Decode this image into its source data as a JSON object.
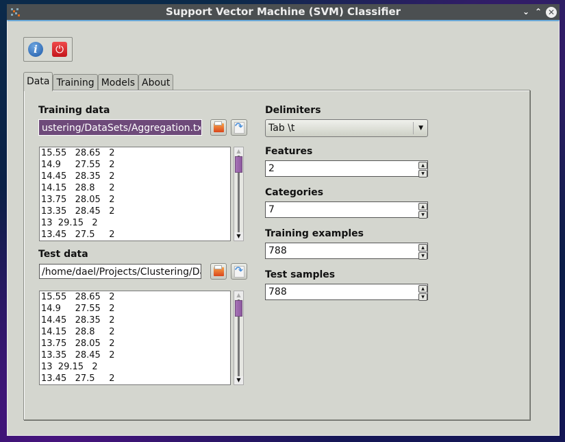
{
  "window": {
    "title": "Support Vector Machine (SVM) Classifier",
    "controls": {
      "minimize": "⌄",
      "maximize": "⌃",
      "close": "✕"
    }
  },
  "toolbar": {
    "info_icon": "i",
    "power_icon": "⏻"
  },
  "tabs": [
    {
      "label": "Data",
      "active": true
    },
    {
      "label": "Training",
      "active": false
    },
    {
      "label": "Models",
      "active": false
    },
    {
      "label": "About",
      "active": false
    }
  ],
  "data_tab": {
    "training_data": {
      "label": "Training data",
      "path_value": "ustering/DataSets/Aggregation.txt",
      "rows": [
        "15.55   28.65   2",
        "14.9     27.55   2",
        "14.45   28.35   2",
        "14.15   28.8     2",
        "13.75   28.05   2",
        "13.35   28.45   2",
        "13  29.15   2",
        "13.45   27.5     2"
      ]
    },
    "test_data": {
      "label": "Test data",
      "path_value": "/home/dael/Projects/Clustering/Da",
      "rows": [
        "15.55   28.65   2",
        "14.9     27.55   2",
        "14.45   28.35   2",
        "14.15   28.8     2",
        "13.75   28.05   2",
        "13.35   28.45   2",
        "13  29.15   2",
        "13.45   27.5     2"
      ]
    },
    "delimiters": {
      "label": "Delimiters",
      "selected": "Tab \\t"
    },
    "features": {
      "label": "Features",
      "value": "2"
    },
    "categories": {
      "label": "Categories",
      "value": "7"
    },
    "training_examples": {
      "label": "Training examples",
      "value": "788"
    },
    "test_samples": {
      "label": "Test samples",
      "value": "788"
    }
  }
}
